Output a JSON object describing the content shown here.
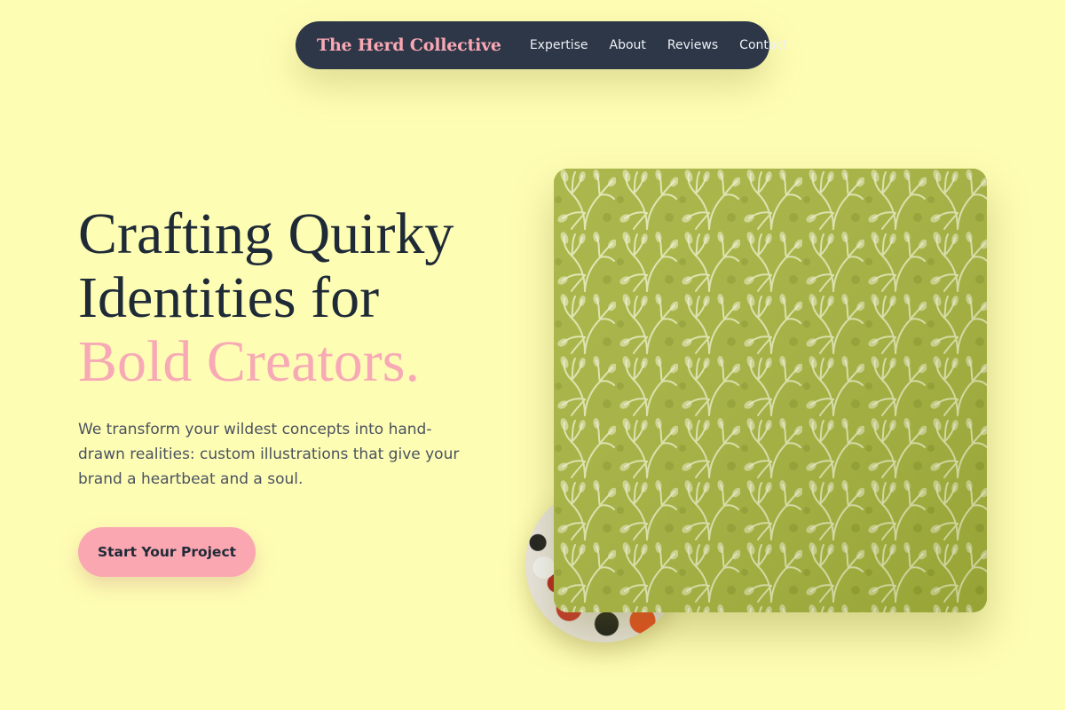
{
  "nav": {
    "brand": "The Herd Collective",
    "links": [
      {
        "label": "Expertise"
      },
      {
        "label": "About"
      },
      {
        "label": "Reviews"
      },
      {
        "label": "Contact"
      }
    ]
  },
  "hero": {
    "title_line1": "Crafting Quirky",
    "title_line2": "Identities for",
    "title_accent": "Bold Creators.",
    "description": "We transform your wildest concepts into hand-drawn realities: custom illustrations that give your brand a heartbeat and a soul.",
    "cta_label": "Start Your Project"
  },
  "colors": {
    "background": "#fefdb4",
    "nav_bg": "#2d3748",
    "brand": "#f9a8b4",
    "accent": "#f7aab5",
    "cta_bg": "#fba7b2",
    "text_dark": "#1f2a37",
    "pattern_green": "#a2b03a"
  }
}
